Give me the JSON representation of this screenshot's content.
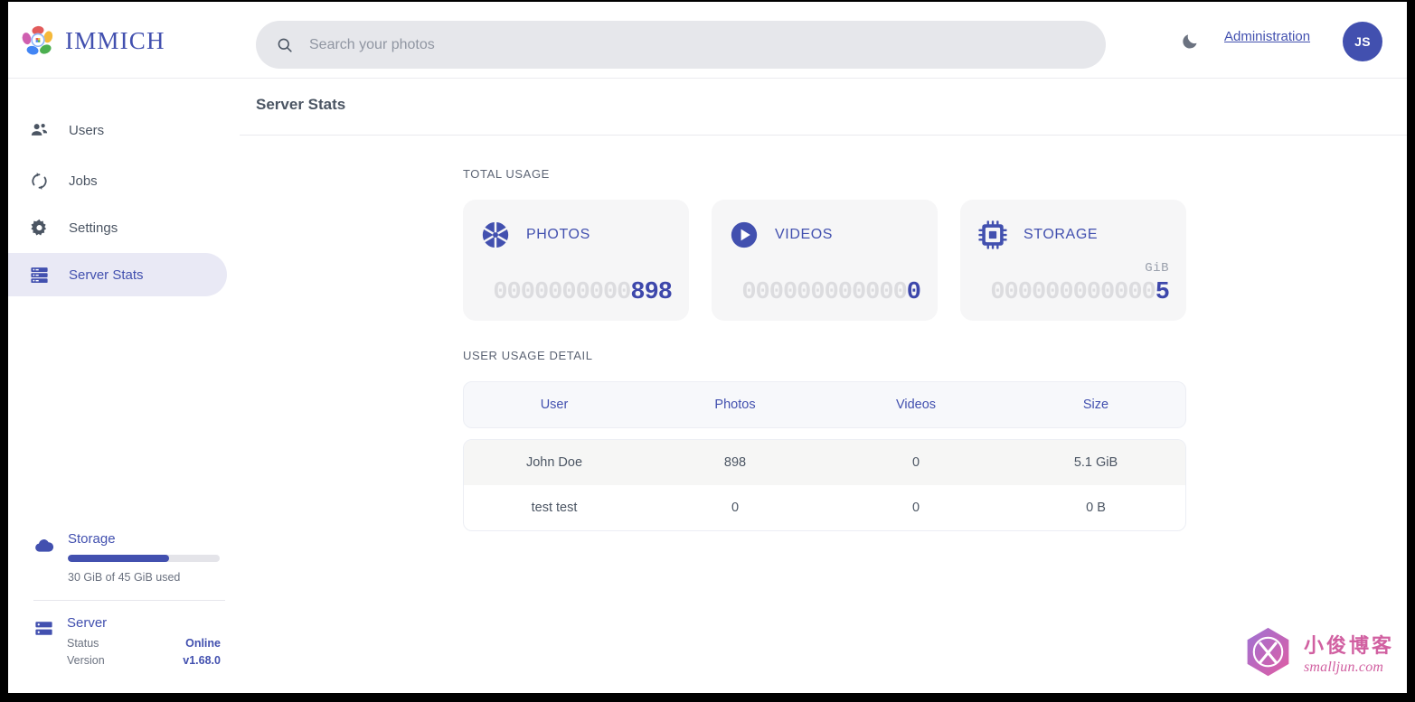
{
  "app": {
    "brand": "IMMICH",
    "logo_icon": "immich-flower-logo"
  },
  "header": {
    "search": {
      "placeholder": "Search your photos",
      "value": "",
      "icon": "search-icon"
    },
    "theme_toggle_icon": "moon-icon",
    "admin_link": "Administration",
    "avatar_initials": "JS"
  },
  "sidebar": {
    "items": [
      {
        "label": "Users",
        "icon": "people-icon",
        "active": false
      },
      {
        "label": "Jobs",
        "icon": "sync-icon",
        "active": false
      },
      {
        "label": "Settings",
        "icon": "gear-icon",
        "active": false
      },
      {
        "label": "Server Stats",
        "icon": "server-icon",
        "active": true
      }
    ],
    "storage": {
      "title": "Storage",
      "icon": "cloud-icon",
      "percent": 66.7,
      "caption": "30 GiB of 45 GiB used"
    },
    "server": {
      "title": "Server",
      "icon": "server-icon",
      "rows": [
        {
          "key": "Status",
          "value": "Online"
        },
        {
          "key": "Version",
          "value": "v1.68.0"
        }
      ]
    }
  },
  "main": {
    "page_title": "Server Stats",
    "total_usage_label": "TOTAL USAGE",
    "cards": [
      {
        "name": "PHOTOS",
        "icon": "aperture-icon",
        "zeros": "0000000000",
        "value": "898",
        "unit": ""
      },
      {
        "name": "VIDEOS",
        "icon": "play-circle-icon",
        "zeros": "000000000000",
        "value": "0",
        "unit": ""
      },
      {
        "name": "STORAGE",
        "icon": "chip-icon",
        "zeros": "000000000000",
        "value": "5",
        "unit": "GiB"
      }
    ],
    "user_usage_label": "USER USAGE DETAIL",
    "table": {
      "columns": [
        "User",
        "Photos",
        "Videos",
        "Size"
      ],
      "rows": [
        {
          "user": "John Doe",
          "photos": "898",
          "videos": "0",
          "size": "5.1 GiB"
        },
        {
          "user": "test test",
          "photos": "0",
          "videos": "0",
          "size": "0 B"
        }
      ]
    }
  },
  "watermark": {
    "cn": "小俊博客",
    "en": "smalljun.com",
    "logo_icon": "smalljun-hex-logo"
  },
  "colors": {
    "accent": "#4250af",
    "card_bg": "#f6f6f7",
    "zero_gray": "#dcdcdf",
    "sidebar_active_bg": "#e9e9f5"
  }
}
